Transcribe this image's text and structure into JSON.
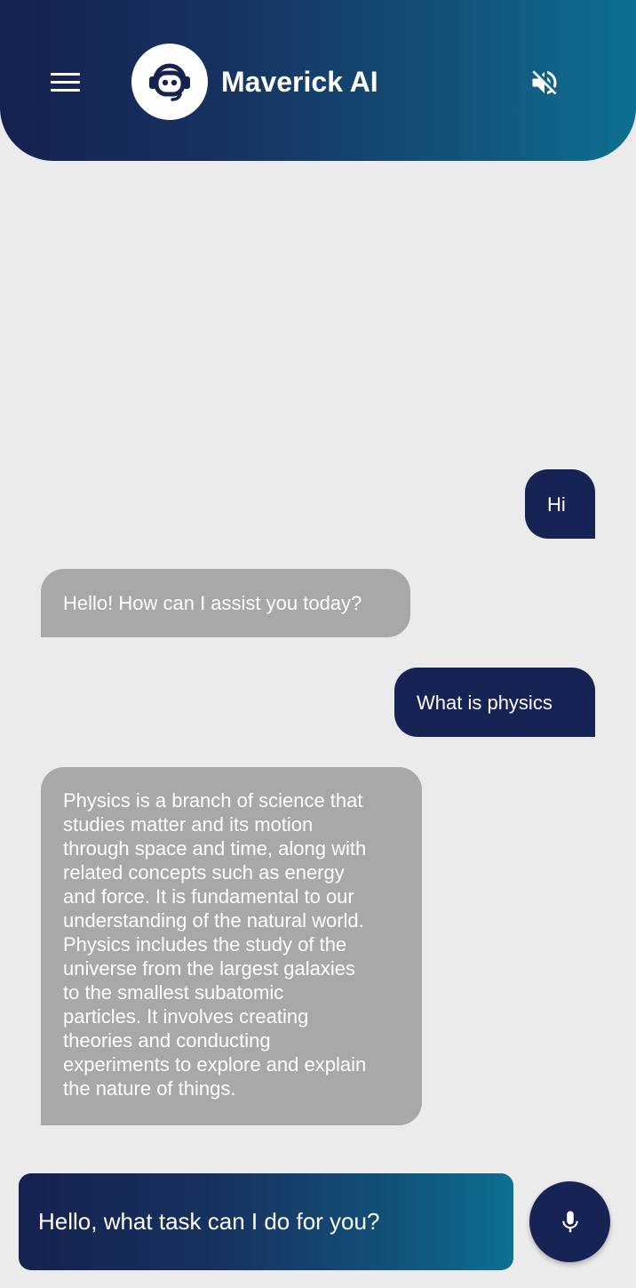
{
  "header": {
    "title": "Maverick AI",
    "menu_icon": "hamburger-menu-icon",
    "avatar_icon": "robot-headset-icon",
    "mute_icon": "volume-off-icon",
    "gradient_start": "#16214f",
    "gradient_end": "#0e7091"
  },
  "messages": [
    {
      "role": "user",
      "text": "Hi"
    },
    {
      "role": "bot",
      "text": "Hello! How can I assist you today?"
    },
    {
      "role": "user",
      "text": "What is physics"
    },
    {
      "role": "bot",
      "lines": [
        "Physics is a branch of science that",
        "studies matter and its motion",
        "through space and time, along with",
        "related concepts such as energy",
        "and force. It is fundamental to our",
        "understanding of the natural world.",
        "Physics includes the study of the",
        "universe from the largest galaxies",
        "to the smallest subatomic",
        "particles. It involves creating",
        "theories and conducting",
        "experiments to explore and explain",
        "the nature of things."
      ]
    }
  ],
  "input": {
    "prompt_text": "Hello, what task can I do for you?"
  },
  "mic": {
    "icon": "microphone-icon"
  },
  "colors": {
    "user_bubble": "#172354",
    "bot_bubble": "#a9a8a6",
    "background": "#ebebeb"
  }
}
